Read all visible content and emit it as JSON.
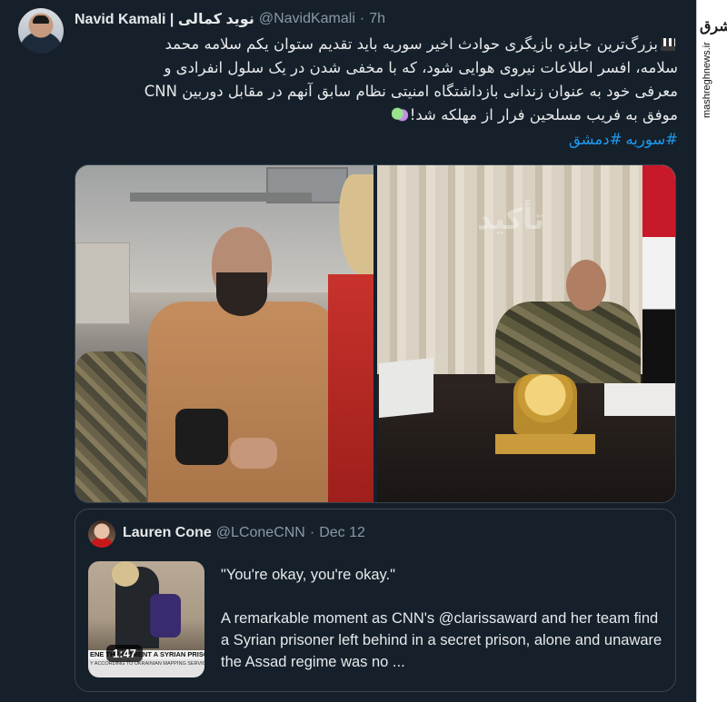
{
  "tweet": {
    "display_name": "Navid Kamali | نوید کمالی",
    "handle": "@NavidKamali",
    "separator": "·",
    "time": "7h",
    "text_line1": "بزرگ‌ترین جایزه بازیگری حوادث اخیر سوریه باید تقدیم ستوان یکم سلامه محمد",
    "text_line2": "سلامه، افسر اطلاعات نیروی هوایی شود، که با مخفی شدن در یک سلول انفرادی و",
    "text_line3": "معرفی خود به عنوان زندانی بازداشتگاه امنیتی نظام سابق آنهم در مقابل دوربین CNN",
    "text_line4": "موفق به فریب مسلحین فرار از مهلکه شد!",
    "hashtags": [
      "#سوریه",
      "#دمشق"
    ]
  },
  "media": {
    "right_watermark": "تأکید"
  },
  "quote": {
    "display_name": "Lauren Cone",
    "handle": "@LConeCNN",
    "separator": "·",
    "date": "Dec 12",
    "quote_line": "\"You're okay, you're okay.\"",
    "body": "A remarkable moment as CNN's @clarissaward and her team find a Syrian prisoner left behind in a secret prison, alone and unaware the Assad regime was no ...",
    "video_duration": "1:47",
    "video_banner": "ENE THE MOMENT A SYRIAN PRISONER IS FRE",
    "video_strip": "Y ACCORDING TO UKRAINIAN MAPPING SERVICE DEEPST"
  },
  "watermark": {
    "logo": "مشرق",
    "site": "mashreghnews.ir"
  },
  "colors": {
    "background": "#15202b",
    "text": "#e7e9ea",
    "muted": "#8b98a5",
    "link": "#1d9bf0",
    "border": "#38444d"
  },
  "icons": [
    "clapper-board-emoji",
    "theater-masks-emoji"
  ]
}
